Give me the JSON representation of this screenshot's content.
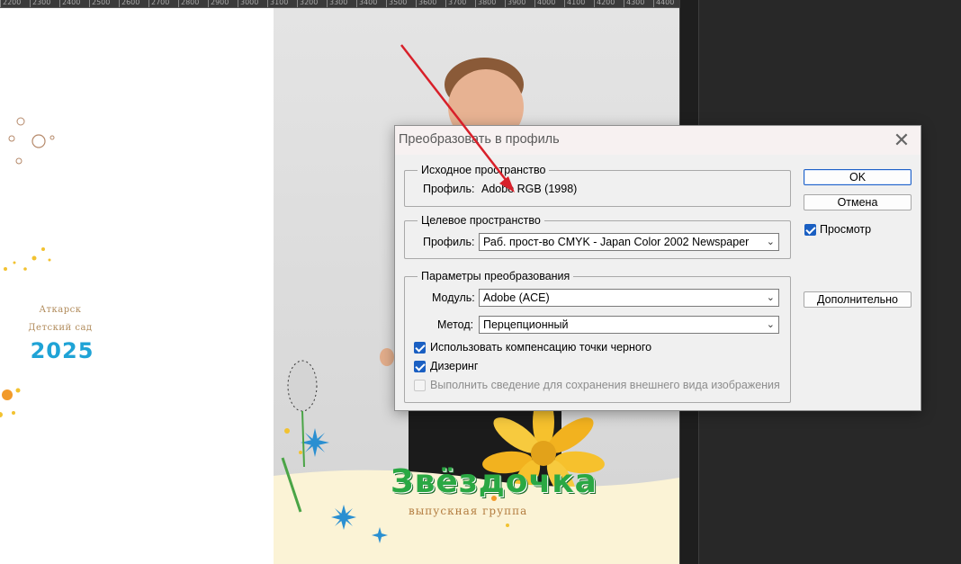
{
  "dialog": {
    "title": "Преобразовать в профиль",
    "close_glyph": "✕",
    "source": {
      "legend": "Исходное пространство",
      "profile_label": "Профиль:",
      "profile_value": "Adobe RGB (1998)"
    },
    "target": {
      "legend": "Целевое пространство",
      "profile_label": "Профиль:",
      "profile_value": "Раб. прост-во CMYK - Japan Color 2002 Newspaper"
    },
    "conversion": {
      "legend": "Параметры преобразования",
      "engine_label": "Модуль:",
      "engine_value": "Adobe (ACE)",
      "intent_label": "Метод:",
      "intent_value": "Перцепционный",
      "black_point": {
        "label": "Использовать компенсацию точки черного",
        "checked": true
      },
      "dither": {
        "label": "Дизеринг",
        "checked": true
      },
      "flatten": {
        "label": "Выполнить сведение для сохранения внешнего вида изображения",
        "checked": false,
        "disabled": true
      }
    },
    "buttons": {
      "ok": "OK",
      "cancel": "Отмена",
      "preview": "Просмотр",
      "advanced": "Дополнительно"
    },
    "preview_checked": true
  },
  "document": {
    "city": "Аткарск",
    "subtitle": "Детский сад",
    "year": "2025",
    "logo_text": "Звёздочка",
    "logo_sub": "выпускная группа"
  },
  "ruler": {
    "labels": [
      "2200",
      "2300",
      "2400",
      "2500",
      "2600",
      "2700",
      "2800",
      "2900",
      "3000",
      "3100",
      "3200",
      "3300",
      "3400",
      "3500",
      "3600",
      "3700",
      "3800",
      "3900",
      "4000",
      "4100",
      "4200",
      "4300",
      "4400"
    ]
  },
  "colors": {
    "accent": "#1a5fc2",
    "arrow": "#d8202a",
    "logo_green": "#2aa843",
    "year_blue": "#1fa3d6"
  }
}
